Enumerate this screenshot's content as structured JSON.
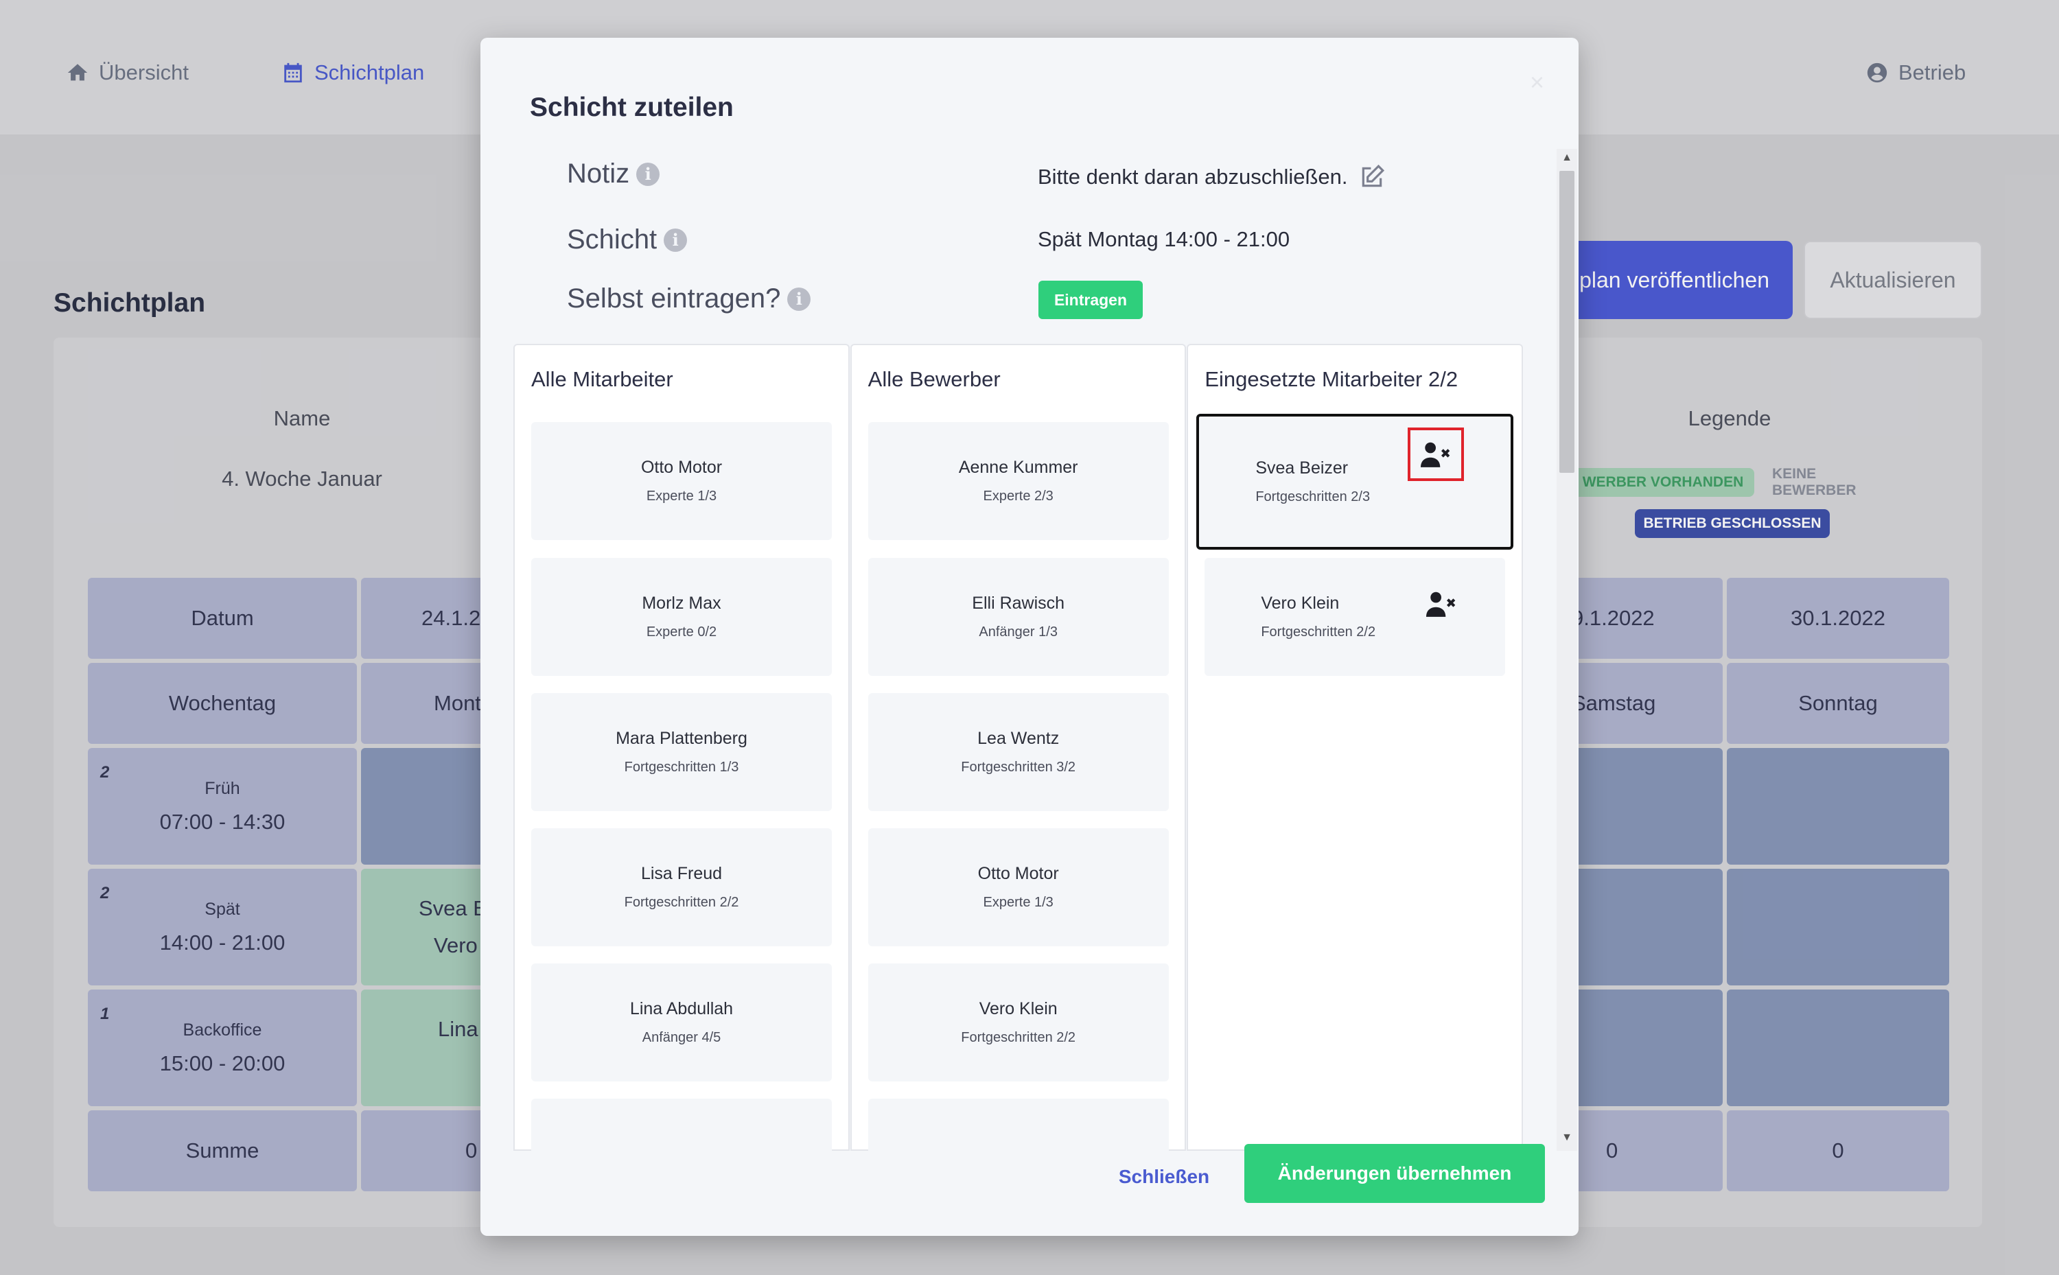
{
  "nav": {
    "overview_label": "Übersicht",
    "schedule_label": "Schichtplan",
    "account_label": "Betrieb"
  },
  "page": {
    "title": "Schichtplan",
    "publish_label": "plan veröffentlichen",
    "refresh_label": "Aktualisieren"
  },
  "plan": {
    "name_header": "Name",
    "week_label": "4. Woche Januar",
    "legend": {
      "title": "Legende",
      "applicants_present": "WERBER VORHANDEN",
      "no_applicants": "KEINE BEWERBER",
      "closed": "BETRIEB GESCHLOSSEN"
    },
    "row_labels": {
      "date": "Datum",
      "weekday": "Wochentag",
      "sum": "Summe"
    },
    "shifts": [
      {
        "count": "2",
        "name": "Früh",
        "time": "07:00 - 14:30"
      },
      {
        "count": "2",
        "name": "Spät",
        "time": "14:00 - 21:00"
      },
      {
        "count": "1",
        "name": "Backoffice",
        "time": "15:00 - 20:00"
      }
    ],
    "columns": [
      {
        "date": "24.1.2",
        "weekday": "Mont",
        "late": "Svea B",
        "late2": "Vero",
        "backoffice": "Lina",
        "sum": "0"
      },
      {
        "date": "9.1.2022",
        "weekday": "Samstag",
        "sum": "0"
      },
      {
        "date": "30.1.2022",
        "weekday": "Sonntag",
        "sum": "0"
      }
    ]
  },
  "modal": {
    "title": "Schicht zuteilen",
    "close_glyph": "×",
    "note_label": "Notiz",
    "note_value": "Bitte denkt daran abzuschließen.",
    "shift_label": "Schicht",
    "shift_value": "Spät Montag 14:00 - 21:00",
    "self_label": "Selbst eintragen?",
    "self_button": "Eintragen",
    "all_employees_title": "Alle Mitarbeiter",
    "all_employees": [
      {
        "name": "Otto Motor",
        "level": "Experte 1/3"
      },
      {
        "name": "Morlz Max",
        "level": "Experte 0/2"
      },
      {
        "name": "Mara Plattenberg",
        "level": "Fortgeschritten 1/3"
      },
      {
        "name": "Lisa Freud",
        "level": "Fortgeschritten 2/2"
      },
      {
        "name": "Lina Abdullah",
        "level": "Anfänger 4/5"
      }
    ],
    "applicants_title": "Alle Bewerber",
    "applicants": [
      {
        "name": "Aenne Kummer",
        "level": "Experte 2/3"
      },
      {
        "name": "Elli Rawisch",
        "level": "Anfänger 1/3"
      },
      {
        "name": "Lea Wentz",
        "level": "Fortgeschritten 3/2"
      },
      {
        "name": "Otto Motor",
        "level": "Experte 1/3"
      },
      {
        "name": "Vero Klein",
        "level": "Fortgeschritten 2/2"
      }
    ],
    "assigned_title": "Eingesetzte Mitarbeiter 2/2",
    "assigned": [
      {
        "name": "Svea Beizer",
        "level": "Fortgeschritten 2/3"
      },
      {
        "name": "Vero Klein",
        "level": "Fortgeschritten 2/2"
      }
    ],
    "footer": {
      "close_label": "Schließen",
      "apply_label": "Änderungen übernehmen"
    }
  },
  "colors": {
    "accent": "#4c5bd6",
    "success": "#2fcf7c",
    "highlight": "#e0242c",
    "cell_header": "#b0b4d0",
    "cell_closed": "#8796b8",
    "cell_assigned": "#a8ccbb"
  },
  "icons": {
    "overview": "home-icon",
    "schedule": "calendar-icon",
    "account": "user-circle-icon",
    "info": "info-circle-icon",
    "edit": "edit-icon",
    "remove": "user-remove-icon"
  }
}
